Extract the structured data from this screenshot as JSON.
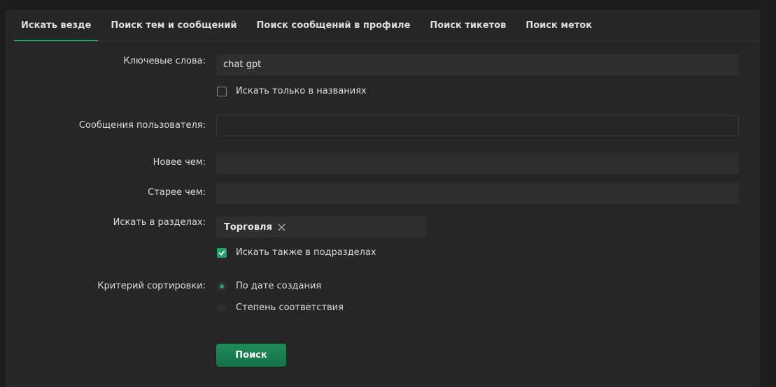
{
  "tabs": [
    {
      "label": "Искать везде",
      "active": true
    },
    {
      "label": "Поиск тем и сообщений",
      "active": false
    },
    {
      "label": "Поиск сообщений в профиле",
      "active": false
    },
    {
      "label": "Поиск тикетов",
      "active": false
    },
    {
      "label": "Поиск меток",
      "active": false
    }
  ],
  "form": {
    "keywords_label": "Ключевые слова:",
    "keywords_value": "chat gpt",
    "titles_only_label": "Искать только в названиях",
    "titles_only_checked": false,
    "user_posts_label": "Сообщения пользователя:",
    "user_posts_value": "",
    "newer_than_label": "Новее чем:",
    "newer_than_value": "",
    "older_than_label": "Старее чем:",
    "older_than_value": "",
    "sections_label": "Искать в разделах:",
    "section_tag": "Торговля",
    "subsections_label": "Искать также в подразделах",
    "subsections_checked": true,
    "sort_label": "Критерий сортировки:",
    "sort_options": [
      {
        "label": "По дате создания",
        "selected": true
      },
      {
        "label": "Степень соответствия",
        "selected": false
      }
    ],
    "submit_label": "Поиск"
  },
  "colors": {
    "accent": "#1fa36a",
    "panel": "#262626",
    "input": "#2e2e2e"
  }
}
